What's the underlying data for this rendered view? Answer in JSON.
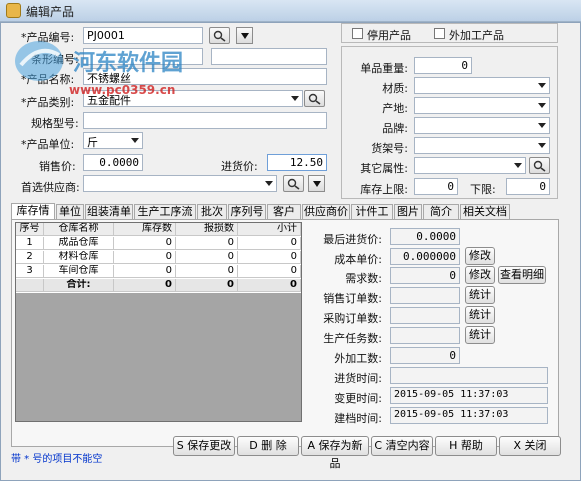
{
  "window": {
    "title": "编辑产品"
  },
  "watermark": {
    "line1": "河东软件园",
    "line2": "www.pc0359.cn"
  },
  "left_form": {
    "code_label": "*产品编号:",
    "code_value": "PJ0001",
    "barcode_label": "条形编号:",
    "barcode_value": "",
    "name_label": "*产品名称:",
    "name_value": "不锈螺丝",
    "category_label": "*产品类别:",
    "category_value": "五金配件",
    "spec_label": "规格型号:",
    "spec_value": "",
    "unit_label": "*产品单位:",
    "unit_value": "斤",
    "sale_price_label": "销售价:",
    "sale_price_value": "0.0000",
    "buy_price_label": "进货价:",
    "buy_price_value": "12.50",
    "supplier_label": "首选供应商:",
    "supplier_value": ""
  },
  "right_form": {
    "disabled_label": "停用产品",
    "outsourced_label": "外加工产品",
    "weight_label": "单品重量:",
    "weight_value": "0",
    "material_label": "材质:",
    "origin_label": "产地:",
    "brand_label": "品牌:",
    "shelf_label": "货架号:",
    "other_attr_label": "其它属性:",
    "stock_upper_label": "库存上限:",
    "stock_upper_value": "0",
    "stock_lower_label": "下限:",
    "stock_lower_value": "0"
  },
  "tabs": [
    {
      "label": "库存情况",
      "active": true
    },
    {
      "label": "单位2"
    },
    {
      "label": "组装清单"
    },
    {
      "label": "生产工序流程"
    },
    {
      "label": "批次"
    },
    {
      "label": "序列号"
    },
    {
      "label": "客户价"
    },
    {
      "label": "供应商价"
    },
    {
      "label": "计件工资"
    },
    {
      "label": "图片"
    },
    {
      "label": "简介"
    },
    {
      "label": "相关文档"
    }
  ],
  "stock_table": {
    "headers": [
      "序号",
      "仓库名称",
      "库存数",
      "报损数",
      "小计"
    ],
    "rows": [
      [
        "1",
        "成品仓库",
        "0",
        "0",
        "0"
      ],
      [
        "2",
        "材料仓库",
        "0",
        "0",
        "0"
      ],
      [
        "3",
        "车间仓库",
        "0",
        "0",
        "0"
      ]
    ],
    "total": [
      "",
      "合计:",
      "0",
      "0",
      "0"
    ]
  },
  "stats": {
    "last_price_label": "最后进货价:",
    "last_price_value": "0.0000",
    "cost_price_label": "成本单价:",
    "cost_price_value": "0.000000",
    "demand_label": "需求数:",
    "demand_value": "0",
    "sales_order_label": "销售订单数:",
    "purchase_order_label": "采购订单数:",
    "production_task_label": "生产任务数:",
    "outsourced_qty_label": "外加工数:",
    "outsourced_qty_value": "0",
    "inbound_time_label": "进货时间:",
    "inbound_time_value": "",
    "changed_time_label": "变更时间:",
    "changed_time_value": "2015-09-05 11:37:03",
    "created_time_label": "建档时间:",
    "created_time_value": "2015-09-05 11:37:03",
    "modify_label": "修改",
    "modify2_label": "修改",
    "view_detail_label": "查看明细",
    "stats_btn1": "统计",
    "stats_btn2": "统计",
    "stats_btn3": "统计"
  },
  "footer": {
    "required_note": "带 * 号的项目不能空",
    "save_changes": "S 保存更改",
    "delete": "D 删 除",
    "save_new": "A 保存为新品",
    "clear": "C 清空内容",
    "help": "H 帮助",
    "close": "X 关闭"
  }
}
